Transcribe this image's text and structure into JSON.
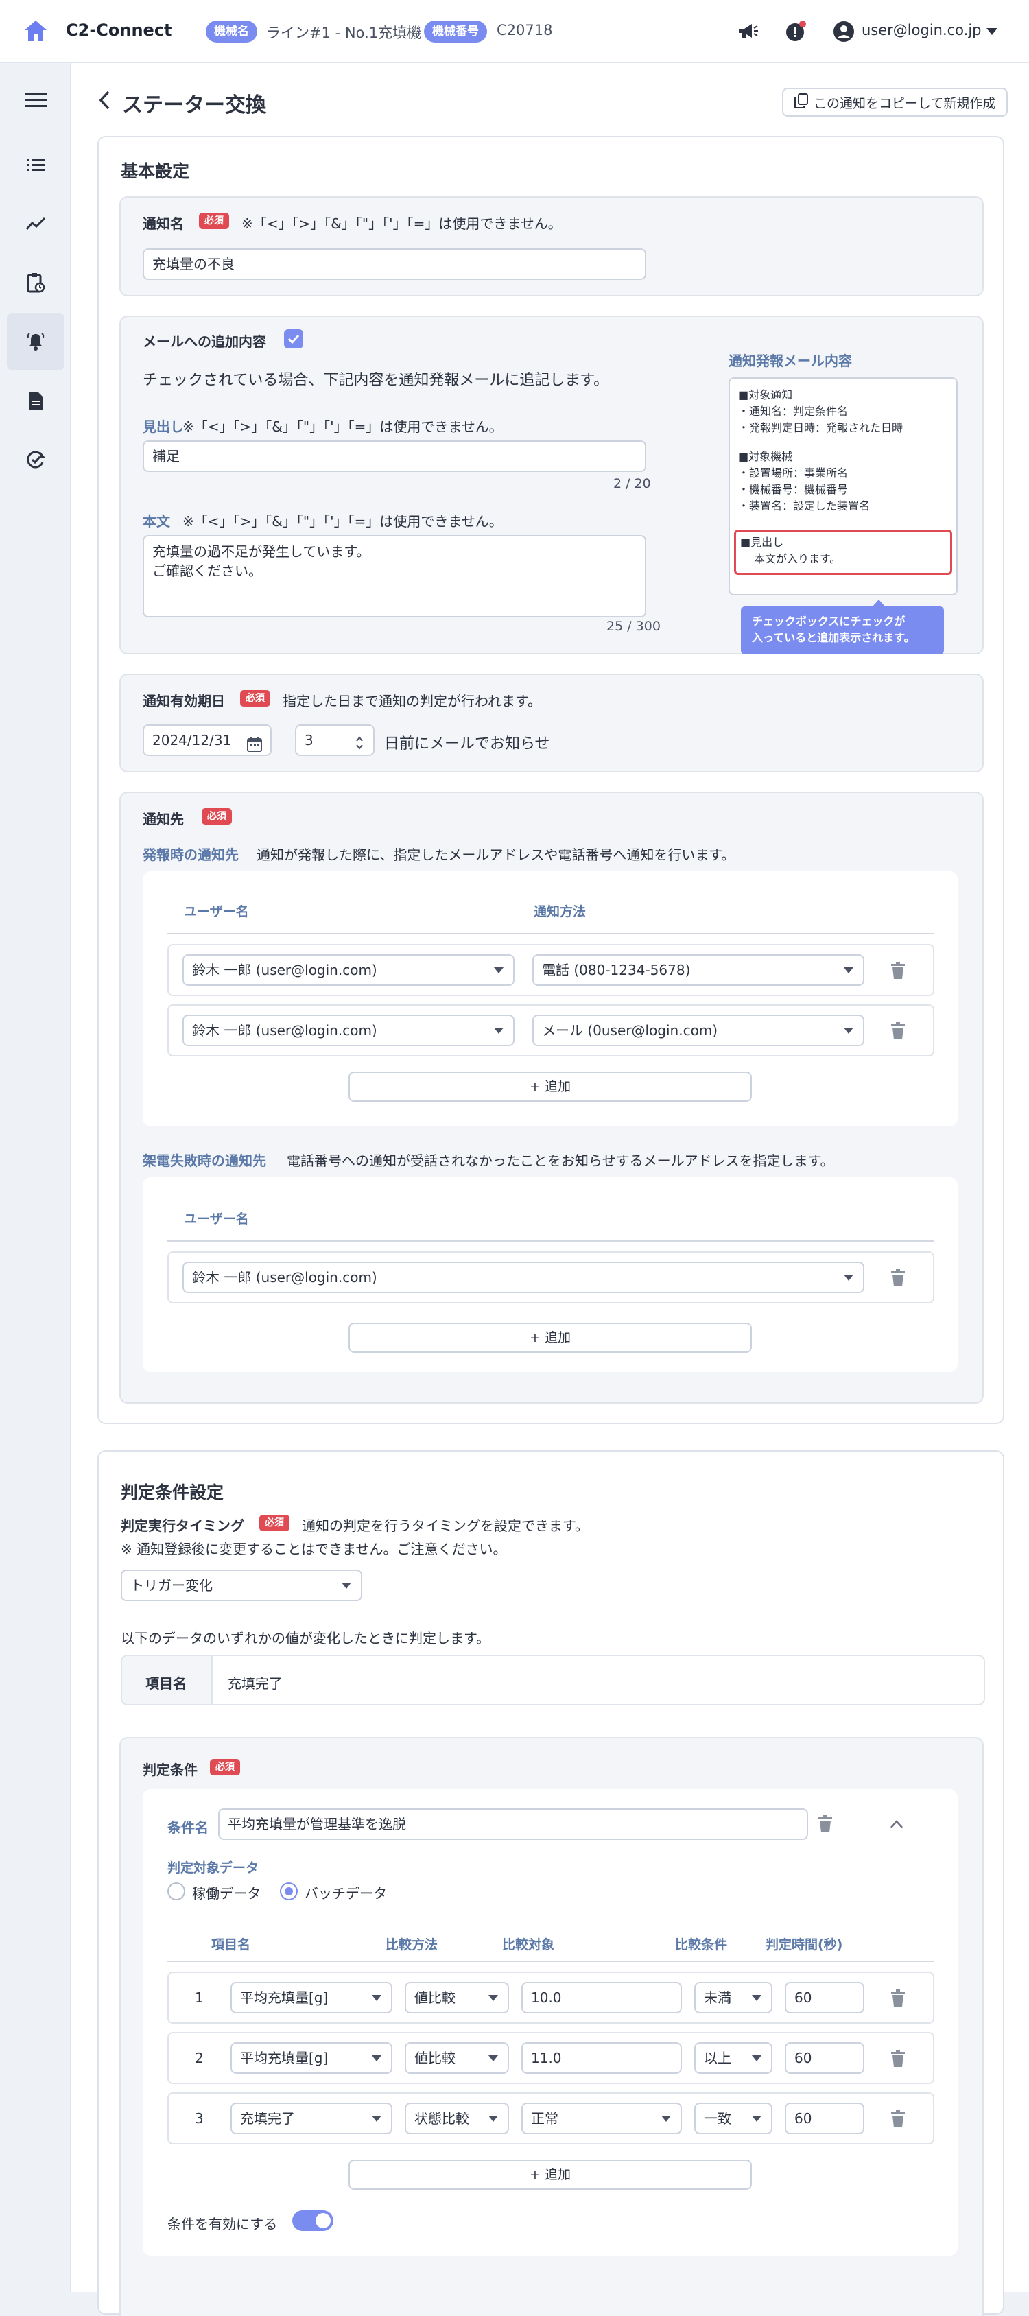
{
  "header": {
    "brand": "C2-Connect",
    "machine_chip": "機械名",
    "machine_name": "ライン#1 - No.1充填機",
    "machine_no_chip": "機械番号",
    "machine_no": "C20718",
    "user_email": "user@login.co.jp"
  },
  "page": {
    "title": "ステーター交換",
    "copy_button": "この通知をコピーして新規作成"
  },
  "basic": {
    "title": "基本設定",
    "name_label": "通知名",
    "required": "必須",
    "name_note": "※「<」「>」「&」「\"」「'」「=」は使用できません。",
    "name_value": "充填量の不良",
    "mail_add_label": "メールへの追加内容",
    "mail_add_desc": "チェックされている場合、下記内容を通知発報メールに追記します。",
    "heading_label": "見出し",
    "heading_note": "※「<」「>」「&」「\"」「'」「=」は使用できません。",
    "heading_value": "補足",
    "heading_counter": "2 / 20",
    "body_label": "本文",
    "body_note": "※「<」「>」「&」「\"」「'」「=」は使用できません。",
    "body_value": "充填量の過不足が発生しています。\nご確認ください。",
    "body_counter": "25 / 300",
    "preview_title": "通知発報メール内容",
    "preview_lines": [
      "■対象通知",
      "・通知名：判定条件名",
      "・発報判定日時：発報された日時",
      "■対象機械",
      "・設置場所：事業所名",
      "・機械番号：機械番号",
      "・装置名：設定した装置名"
    ],
    "preview_highlight_1": "■見出し",
    "preview_highlight_2": "本文が入ります。",
    "tooltip": "チェックボックスにチェックが\n入っていると追加表示されます。",
    "expiry_label": "通知有効期日",
    "expiry_desc": "指定した日まで通知の判定が行われます。",
    "expiry_date": "2024/12/31",
    "expiry_days": "3",
    "expiry_suffix": "日前にメールでお知らせ",
    "dest_label": "通知先",
    "dest_alert_label": "発報時の通知先",
    "dest_alert_desc": "通知が発報した際に、指定したメールアドレスや電話番号へ通知を行います。",
    "col_user": "ユーザー名",
    "col_method": "通知方法",
    "dest_rows": [
      {
        "user": "鈴木 一郎 (user@login.com)",
        "method": "電話 (080-1234-5678)"
      },
      {
        "user": "鈴木 一郎 (user@login.com)",
        "method": "メール (0user@login.com)"
      }
    ],
    "add_label": "+ 追加",
    "dest_fail_label": "架電失敗時の通知先",
    "dest_fail_desc": "電話番号への通知が受話されなかったことをお知らせするメールアドレスを指定します。",
    "fail_rows": [
      {
        "user": "鈴木 一郎 (user@login.com)"
      }
    ]
  },
  "judge": {
    "title": "判定条件設定",
    "timing_label": "判定実行タイミング",
    "timing_desc": "通知の判定を行うタイミングを設定できます。",
    "timing_warning": "※ 通知登録後に変更することはできません。ご注意ください。",
    "timing_value": "トリガー変化",
    "change_desc": "以下のデータのいずれかの値が変化したときに判定します。",
    "item_label": "項目名",
    "item_value": "充填完了",
    "cond_label": "判定条件",
    "cond_name_label": "条件名",
    "cond_name_value": "平均充填量が管理基準を逸脱",
    "target_label": "判定対象データ",
    "radio_operating": "稼働データ",
    "radio_batch": "バッチデータ",
    "cols": [
      "項目名",
      "比較方法",
      "比較対象",
      "比較条件",
      "判定時間(秒)"
    ],
    "rows": [
      {
        "no": "1",
        "item": "平均充填量[g]",
        "method": "値比較",
        "target": "10.0",
        "cond": "未満",
        "time": "60"
      },
      {
        "no": "2",
        "item": "平均充填量[g]",
        "method": "値比較",
        "target": "11.0",
        "cond": "以上",
        "time": "60"
      },
      {
        "no": "3",
        "item": "充填完了",
        "method": "状態比較",
        "target": "正常",
        "cond": "一致",
        "time": "60"
      }
    ],
    "enable_label": "条件を有効にする"
  }
}
